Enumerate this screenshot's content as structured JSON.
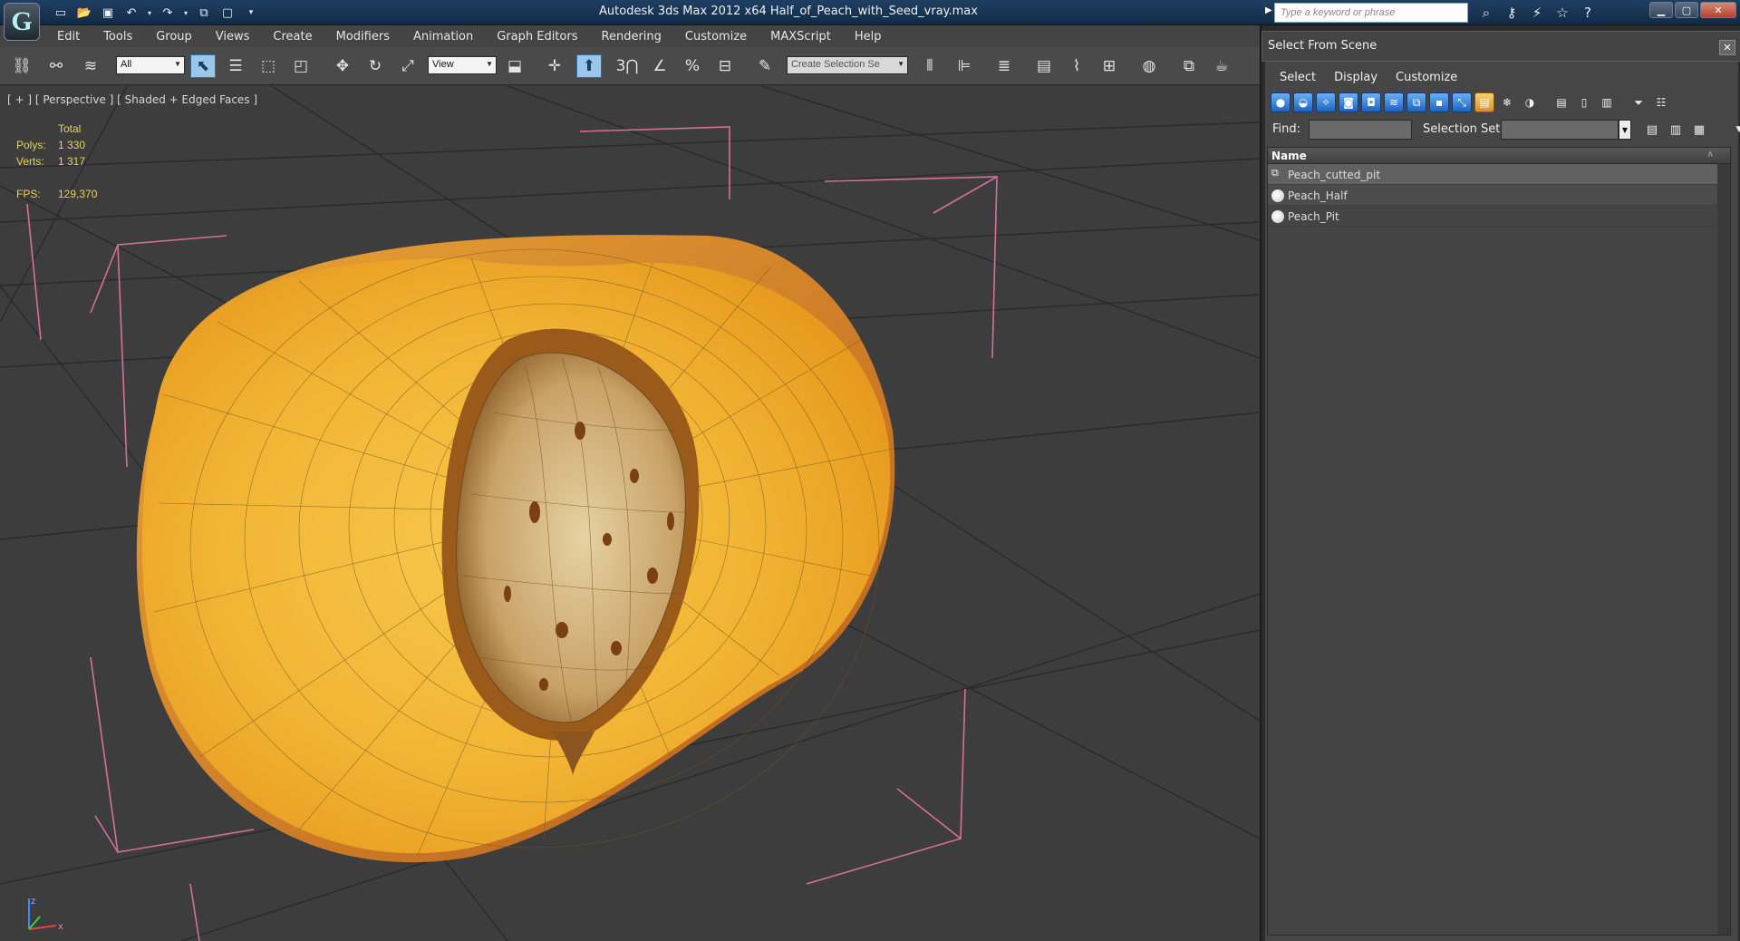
{
  "window": {
    "title": "Autodesk 3ds Max  2012 x64      Half_of_Peach_with_Seed_vray.max",
    "search_placeholder": "Type a keyword or phrase",
    "app_logo": "3ds-max-logo",
    "accent_color": "#1f3f63"
  },
  "menubar": {
    "items": [
      "Edit",
      "Tools",
      "Group",
      "Views",
      "Create",
      "Modifiers",
      "Animation",
      "Graph Editors",
      "Rendering",
      "Customize",
      "MAXScript",
      "Help"
    ]
  },
  "toolbar": {
    "filter_value": "All",
    "ref_coord_value": "View",
    "selection_set_placeholder": "Create Selection Se",
    "snap_label": "3",
    "angle_snap": "%"
  },
  "viewport": {
    "label": "[ + ] [ Perspective ] [ Shaded + Edged Faces ]",
    "stats": {
      "header": "Total",
      "polys_label": "Polys:",
      "polys_value": "1 330",
      "verts_label": "Verts:",
      "verts_value": "1 317",
      "fps_label": "FPS:",
      "fps_value": "129,370"
    },
    "gizmo_labels": [
      "z",
      "x"
    ],
    "stat_color": "#e6d35a",
    "bbox_color": "#d56f9a"
  },
  "scene_panel": {
    "title": "Select From Scene",
    "menu": [
      "Select",
      "Display",
      "Customize"
    ],
    "find_label": "Find:",
    "find_value": "",
    "selection_set_label": "Selection Set:",
    "column_name": "Name",
    "objects": [
      {
        "name": "Peach_cutted_pit",
        "icon": "group-icon",
        "selected": true
      },
      {
        "name": "Peach_Half",
        "icon": "sphere-icon",
        "selected": false
      },
      {
        "name": "Peach_Pit",
        "icon": "sphere-icon",
        "selected": false
      }
    ]
  }
}
